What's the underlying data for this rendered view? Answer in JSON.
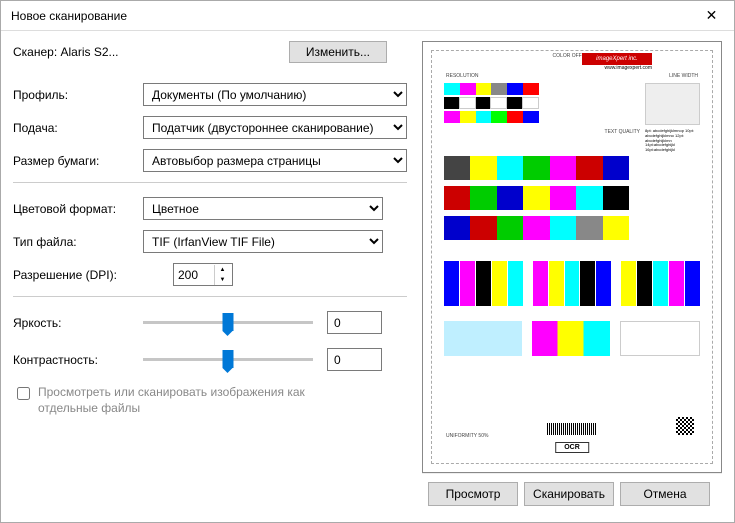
{
  "window": {
    "title": "Новое сканирование"
  },
  "scanner": {
    "label": "Сканер: Alaris S2...",
    "change_btn": "Изменить..."
  },
  "labels": {
    "profile": "Профиль:",
    "source": "Подача:",
    "paper": "Размер бумаги:",
    "color": "Цветовой формат:",
    "filetype": "Тип файла:",
    "dpi": "Разрешение (DPI):",
    "brightness": "Яркость:",
    "contrast": "Контрастность:"
  },
  "values": {
    "profile": "Документы (По умолчанию)",
    "source": "Податчик (двустороннее сканирование)",
    "paper": "Автовыбор размера страницы",
    "color": "Цветное",
    "filetype": "TIF (IrfanView TIF File)",
    "dpi": "200",
    "brightness": "0",
    "contrast": "0"
  },
  "checkbox": {
    "label": "Просмотреть или сканировать изображения как отдельные файлы"
  },
  "buttons": {
    "preview": "Просмотр",
    "scan": "Сканировать",
    "cancel": "Отмена"
  },
  "preview": {
    "logo": "imageXpert inc.",
    "url": "www.imagexpert.com",
    "ocr": "OCR",
    "label_coloroffset": "COLOR OFFSET",
    "label_resolution": "RESOLUTION",
    "label_linewidth": "LINE WIDTH",
    "label_textquality": "TEXT QUALITY",
    "label_uniformity": "UNIFORMITY 50%",
    "typespec": "8pt: abcdefghijklmnop\n10pt: abcdefghijklmno\n12pt: abcdefghijklmn\n14pt:abcdefghijkl\n16pt:abcdefghijkl"
  }
}
